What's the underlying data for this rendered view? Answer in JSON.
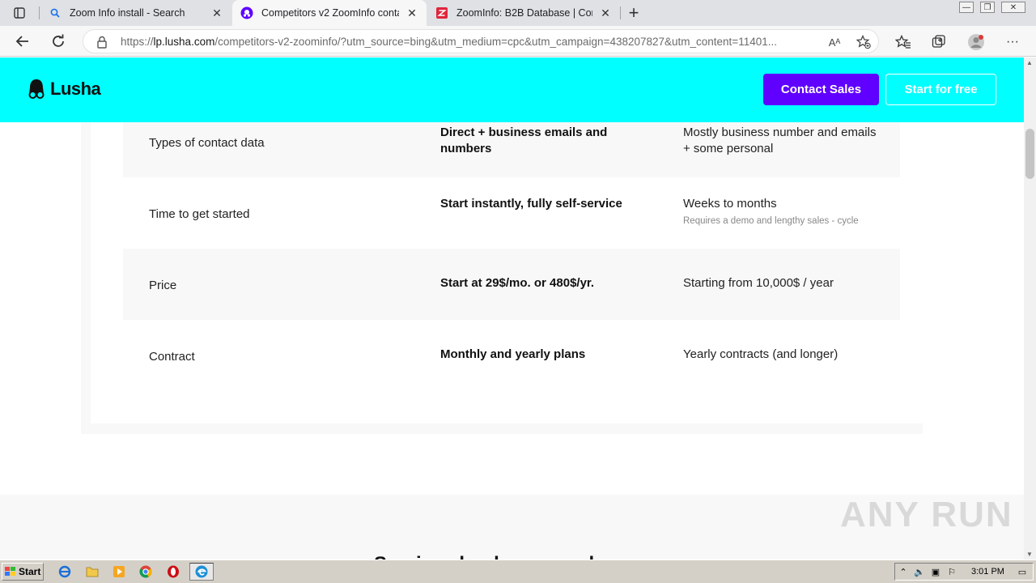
{
  "browser": {
    "tabs": [
      {
        "title": "Zoom Info install - Search",
        "icon": "search-icon",
        "active": false
      },
      {
        "title": "Competitors v2 ZoomInfo contac",
        "icon": "lusha-favicon",
        "active": true
      },
      {
        "title": "ZoomInfo: B2B Database | Comp",
        "icon": "zoominfo-favicon",
        "active": false
      }
    ],
    "url_host": "lp.lusha.com",
    "url_prefix": "https://",
    "url_rest": "/competitors-v2-zoominfo/?utm_source=bing&utm_medium=cpc&utm_campaign=438207827&utm_content=11401...",
    "read_aloud_label": "Aᴬ"
  },
  "header": {
    "logo_text": "Lusha",
    "contact_sales": "Contact Sales",
    "start_free": "Start for free",
    "colors": {
      "bg": "#00ffff",
      "primary": "#6000ff"
    }
  },
  "comparison": {
    "rows": [
      {
        "label": "Types of contact data",
        "lusha": "Direct + business emails and numbers",
        "zoominfo": "Mostly business number and emails + some personal",
        "note": ""
      },
      {
        "label": "Time to get started",
        "lusha": "Start instantly, fully self-service",
        "zoominfo": "Weeks to months",
        "note": "Requires a demo and lengthy sales - cycle"
      },
      {
        "label": "Price",
        "lusha": "Start at 29$/mo. or 480$/yr.",
        "zoominfo": "Starting from 10,000$ / year",
        "note": ""
      },
      {
        "label": "Contract",
        "lusha": "Monthly and yearly plans",
        "zoominfo": "Yearly contracts (and longer)",
        "note": ""
      }
    ]
  },
  "lower": {
    "heading_partial": "Services landscape and"
  },
  "watermark": "ANY RUN",
  "taskbar": {
    "start_label": "Start",
    "clock": "3:01 PM"
  }
}
